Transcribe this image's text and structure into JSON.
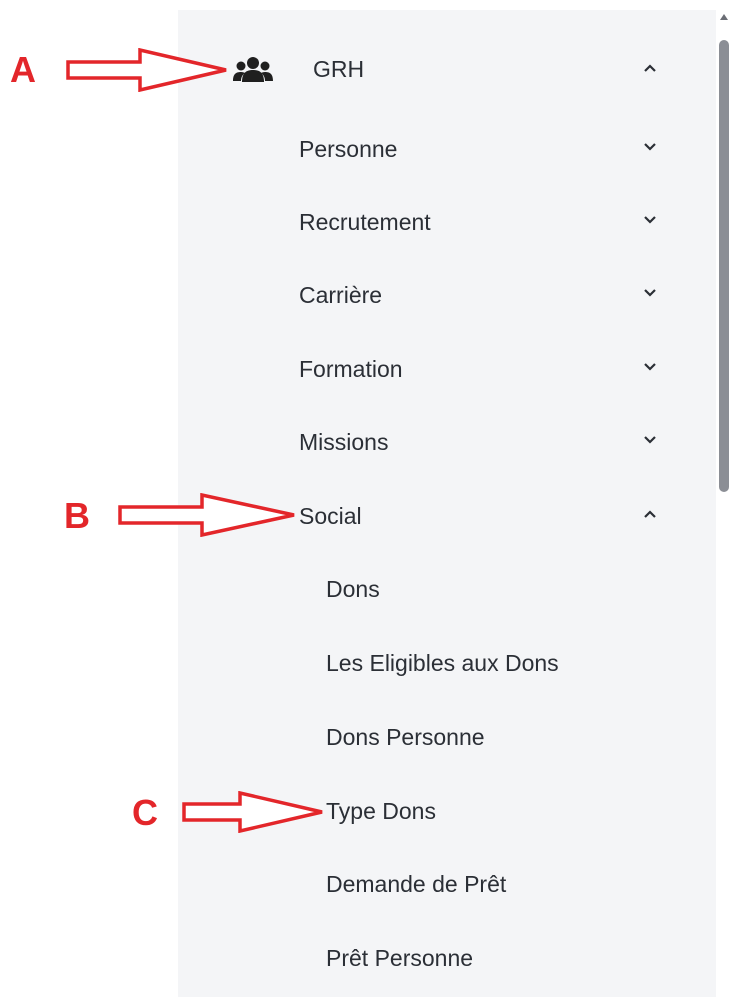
{
  "menu": {
    "root": {
      "label": "GRH",
      "icon": "users-group-icon",
      "expanded": true
    },
    "items": [
      {
        "label": "Personne",
        "expanded": false
      },
      {
        "label": "Recrutement",
        "expanded": false
      },
      {
        "label": "Carrière",
        "expanded": false
      },
      {
        "label": "Formation",
        "expanded": false
      },
      {
        "label": "Missions",
        "expanded": false
      },
      {
        "label": "Social",
        "expanded": true
      }
    ],
    "social_children": [
      {
        "label": "Dons"
      },
      {
        "label": "Les Eligibles aux Dons"
      },
      {
        "label": "Dons Personne"
      },
      {
        "label": "Type Dons"
      },
      {
        "label": "Demande de Prêt"
      },
      {
        "label": "Prêt Personne"
      }
    ]
  },
  "annotations": [
    {
      "letter": "A"
    },
    {
      "letter": "B"
    },
    {
      "letter": "C"
    }
  ],
  "colors": {
    "sidebar_bg": "#f4f5f7",
    "text": "#2b2f36",
    "annotation_red": "#e3262a",
    "scroll_thumb": "#8b8e95"
  }
}
